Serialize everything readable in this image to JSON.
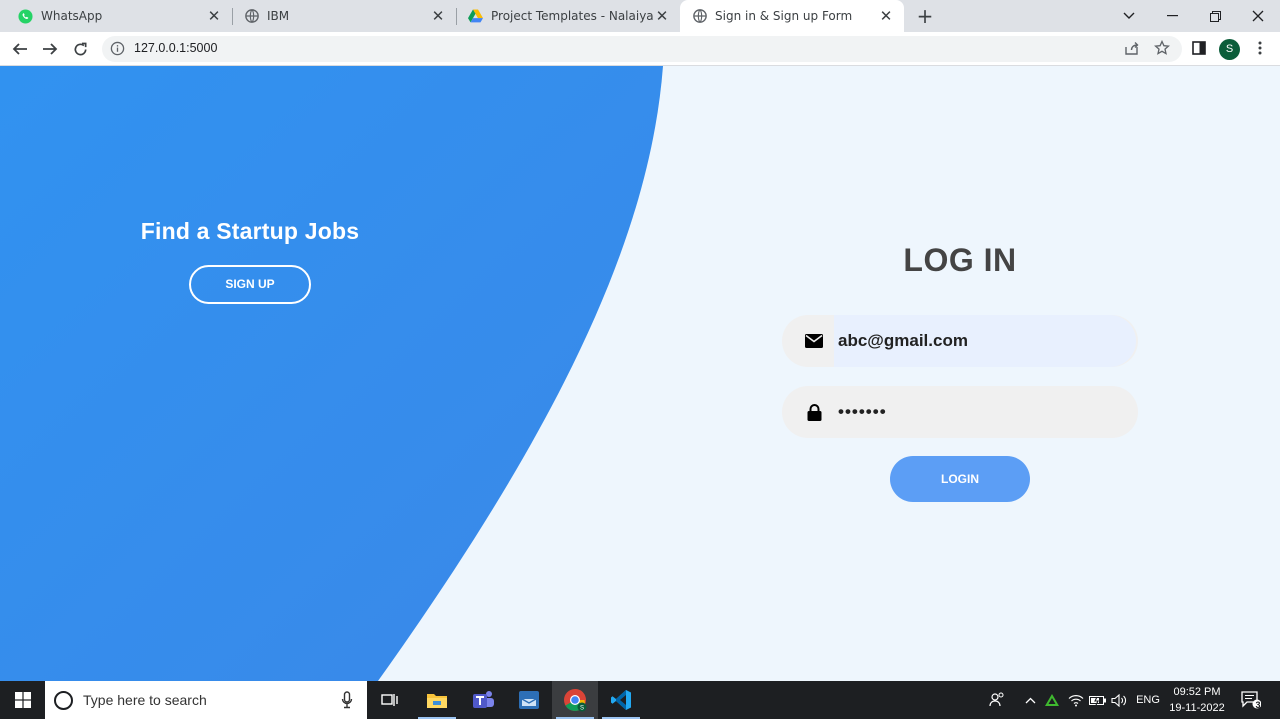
{
  "browser": {
    "tabs": [
      {
        "title": "WhatsApp",
        "icon": "whatsapp-icon"
      },
      {
        "title": "IBM",
        "icon": "globe-icon"
      },
      {
        "title": "Project Templates - Nalaiya Thira",
        "icon": "google-drive-icon"
      },
      {
        "title": "Sign in & Sign up Form",
        "icon": "globe-icon",
        "active": true
      }
    ],
    "url": "127.0.0.1:5000",
    "profile_initial": "S"
  },
  "page": {
    "promo_heading": "Find a Startup Jobs",
    "signup_label": "SIGN UP",
    "login_heading": "LOG IN",
    "email_value": "abc@gmail.com",
    "password_value": "•••••••",
    "login_label": "LOGIN",
    "colors": {
      "panel_blue": "#2f8ff0",
      "background": "#eef6fd",
      "login_button": "#5c9ef5",
      "heading": "#444444"
    }
  },
  "taskbar": {
    "search_placeholder": "Type here to search",
    "language": "ENG",
    "time": "09:52 PM",
    "date": "19-11-2022",
    "notification_count": "3"
  }
}
